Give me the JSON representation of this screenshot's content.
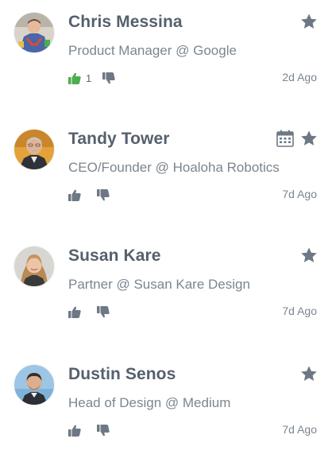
{
  "colors": {
    "name": "#56606d",
    "subtitle": "#7c858f",
    "icon": "#6e7885",
    "upvote_active": "#4cae4c"
  },
  "people": [
    {
      "name": "Chris Messina",
      "title": "Product Manager @ Google",
      "upvotes": "1",
      "time": "2d Ago",
      "upvoted": true,
      "has_calendar": false
    },
    {
      "name": "Tandy Tower",
      "title": "CEO/Founder @ Hoaloha Robotics",
      "upvotes": "",
      "time": "7d Ago",
      "upvoted": false,
      "has_calendar": true
    },
    {
      "name": "Susan Kare",
      "title": "Partner @ Susan Kare Design",
      "upvotes": "",
      "time": "7d Ago",
      "upvoted": false,
      "has_calendar": false
    },
    {
      "name": "Dustin Senos",
      "title": "Head of Design @ Medium",
      "upvotes": "",
      "time": "7d Ago",
      "upvoted": false,
      "has_calendar": false
    }
  ]
}
